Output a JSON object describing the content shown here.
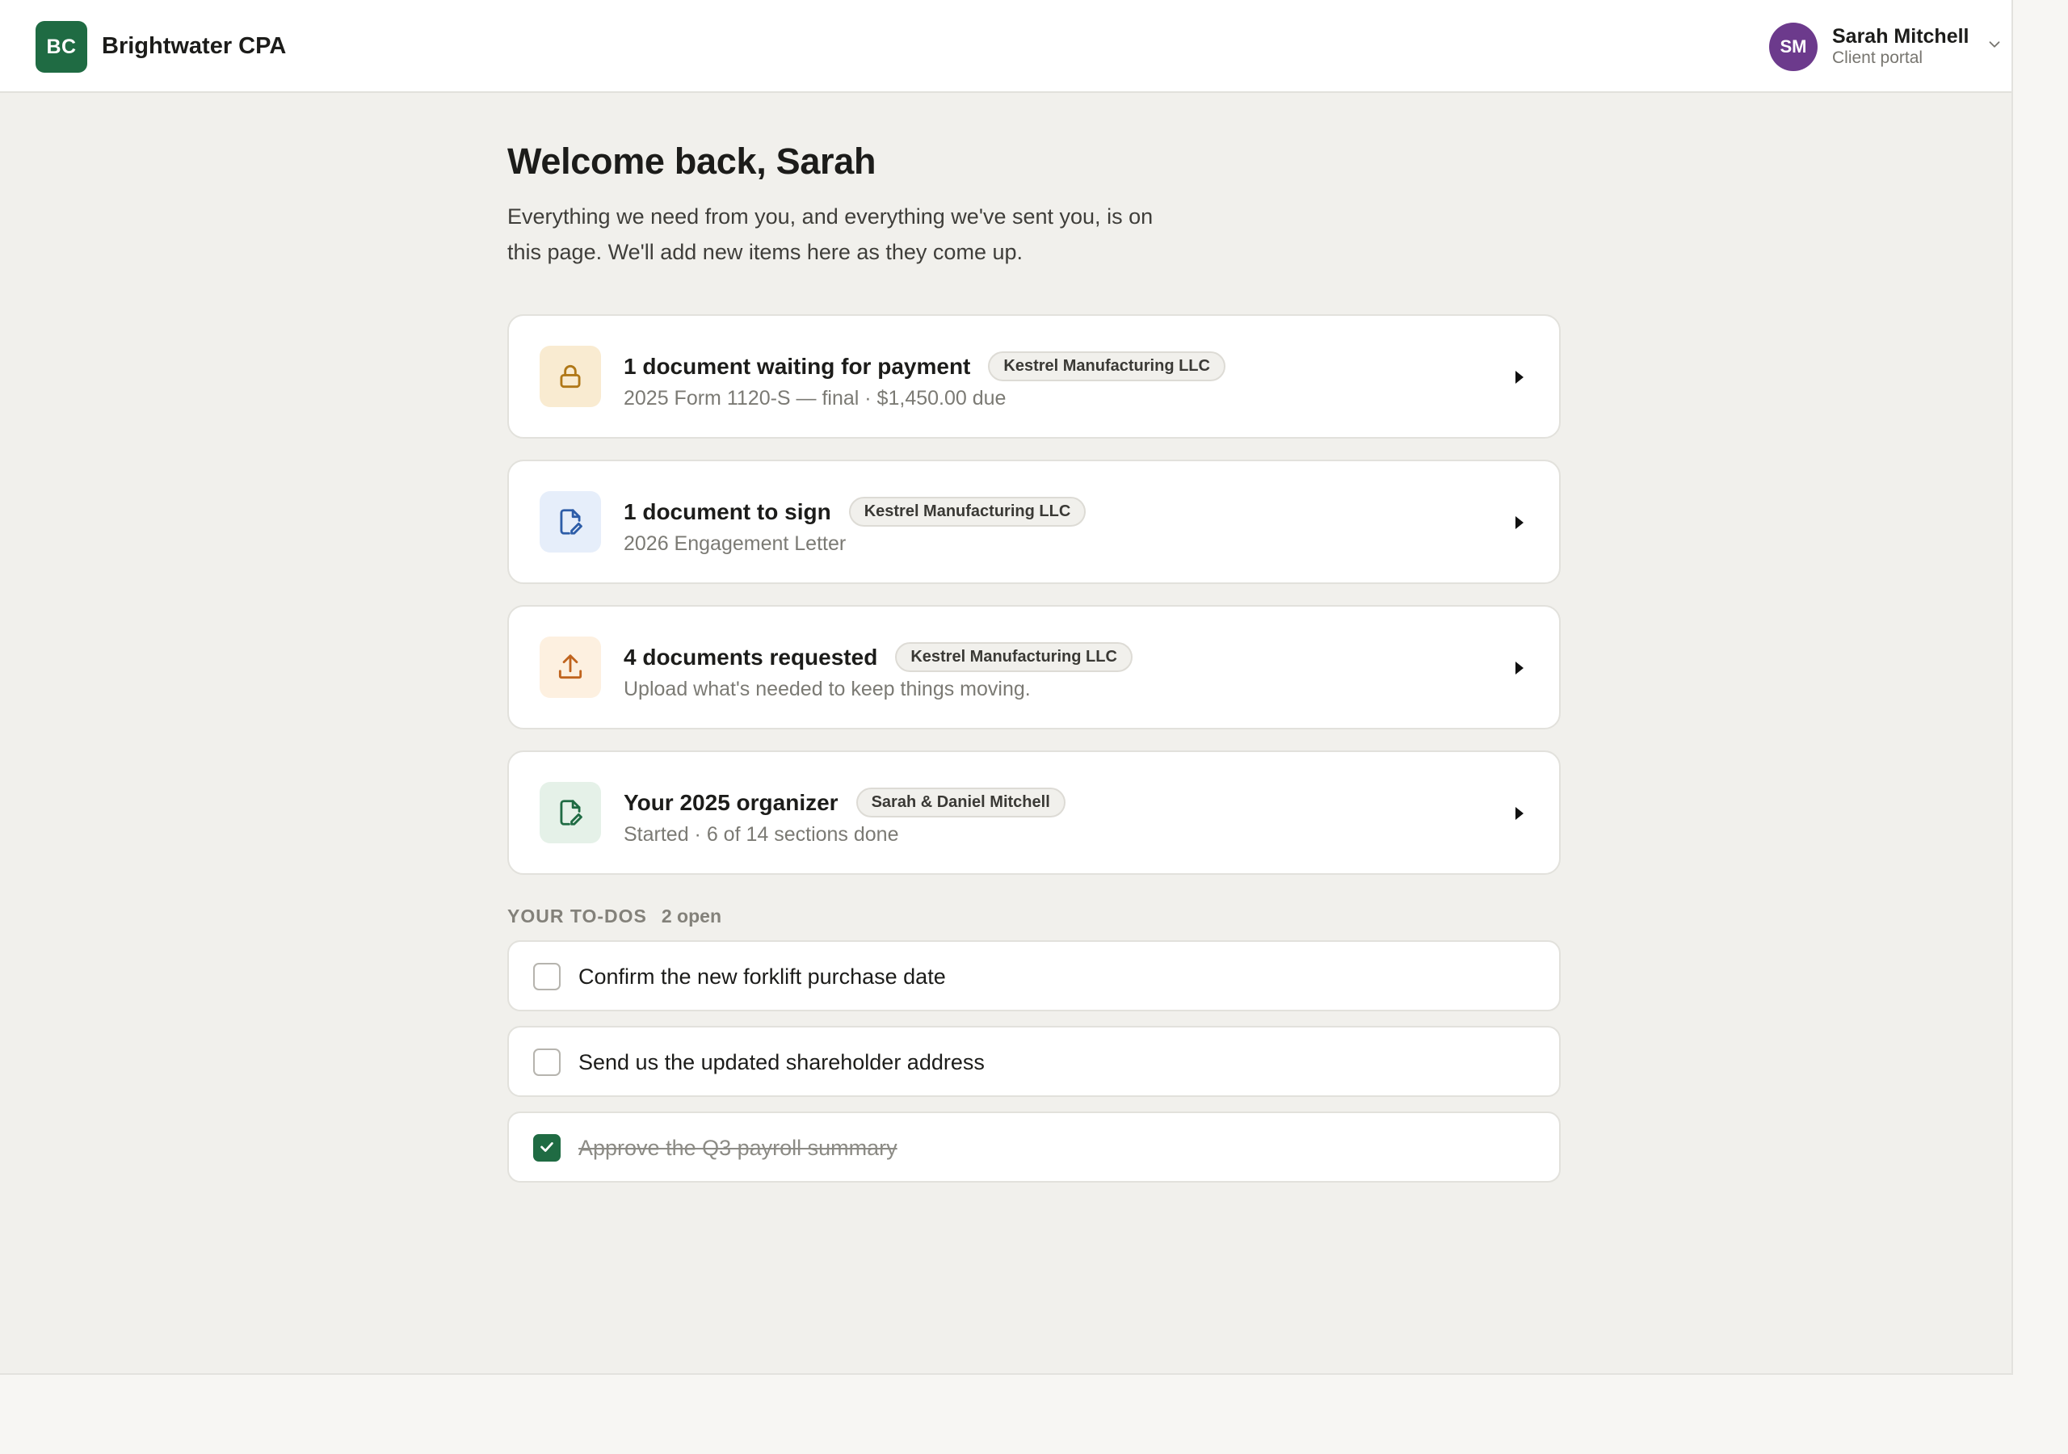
{
  "header": {
    "logo_initials": "BC",
    "firm_name": "Brightwater CPA",
    "user": {
      "initials": "SM",
      "name": "Sarah Mitchell",
      "role": "Client portal",
      "avatar_color": "#6c3a8c"
    }
  },
  "page": {
    "title": "Welcome back, Sarah",
    "intro": "Everything we need from you, and everything we've sent you, is on this page. We'll add new items here as they come up."
  },
  "cards": [
    {
      "icon": "lock-icon",
      "icon_bg": "#f9ebd1",
      "icon_color": "#b07818",
      "title": "1 document waiting for payment",
      "tag": "Kestrel Manufacturing LLC",
      "subtitle": "2025 Form 1120-S — final · $1,450.00 due"
    },
    {
      "icon": "document-sign-icon",
      "icon_bg": "#e6eefa",
      "icon_color": "#2d5da8",
      "title": "1 document to sign",
      "tag": "Kestrel Manufacturing LLC",
      "subtitle": "2026 Engagement Letter"
    },
    {
      "icon": "upload-icon",
      "icon_bg": "#fdf0e0",
      "icon_color": "#c0641e",
      "title": "4 documents requested",
      "tag": "Kestrel Manufacturing LLC",
      "subtitle": "Upload what's needed to keep things moving."
    },
    {
      "icon": "document-edit-icon",
      "icon_bg": "#e5f1e8",
      "icon_color": "#1f6b43",
      "title": "Your 2025 organizer",
      "tag": "Sarah & Daniel Mitchell",
      "subtitle": "Started · 6 of 14 sections done"
    }
  ],
  "todos": {
    "title": "YOUR TO-DOS",
    "count": "2 open",
    "items": [
      {
        "text": "Confirm the new forklift purchase date",
        "done": false
      },
      {
        "text": "Send us the updated shareholder address",
        "done": false
      },
      {
        "text": "Approve the Q3 payroll summary",
        "done": true
      }
    ]
  },
  "colors": {
    "brand": "#1f6b43",
    "page_bg": "#f1f0ec"
  }
}
